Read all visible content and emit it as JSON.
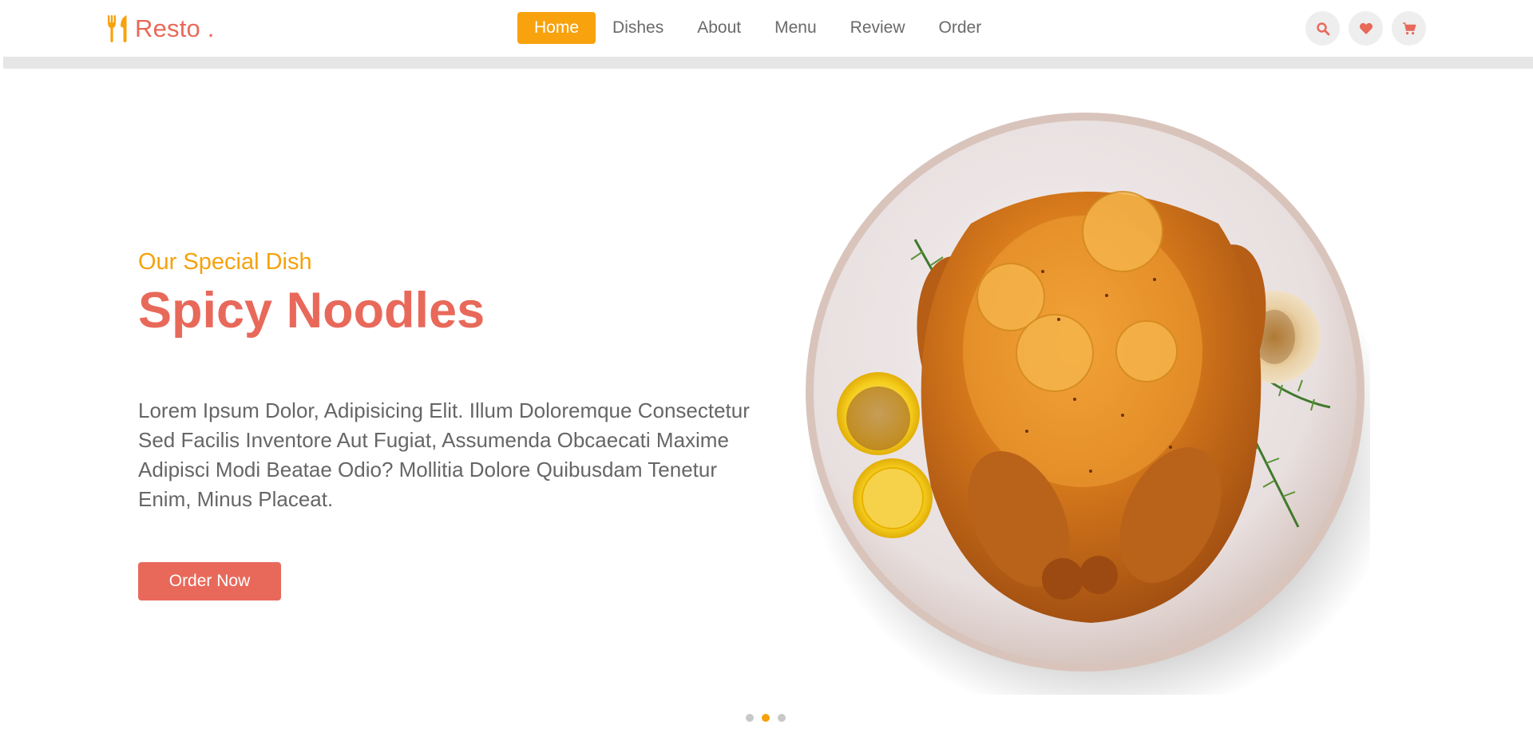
{
  "brand": {
    "name": "Resto .",
    "icon": "utensils-icon",
    "color": "#e8695a",
    "icon_color": "#f8a20e"
  },
  "nav": {
    "items": [
      {
        "label": "Home",
        "active": true
      },
      {
        "label": "Dishes",
        "active": false
      },
      {
        "label": "About",
        "active": false
      },
      {
        "label": "Menu",
        "active": false
      },
      {
        "label": "Review",
        "active": false
      },
      {
        "label": "Order",
        "active": false
      }
    ],
    "active_color": "#f8a20e"
  },
  "header_icons": [
    "search-icon",
    "heart-icon",
    "cart-icon"
  ],
  "hero": {
    "subtitle": "Our Special Dish",
    "title": "Spicy Noodles",
    "description": "Lorem Ipsum Dolor, Adipisicing Elit. Illum Doloremque Consectetur Sed Facilis Inventore Aut Fugiat, Assumenda Obcaecati Maxime Adipisci Modi Beatae Odio? Mollitia Dolore Quibusdam Tenetur Enim, Minus Placeat.",
    "button_label": "Order Now",
    "image": "roast-chicken-plate-image"
  },
  "slider": {
    "count": 3,
    "active_index": 1
  },
  "colors": {
    "accent": "#e8695a",
    "highlight": "#f5a20c",
    "text": "#666666"
  }
}
